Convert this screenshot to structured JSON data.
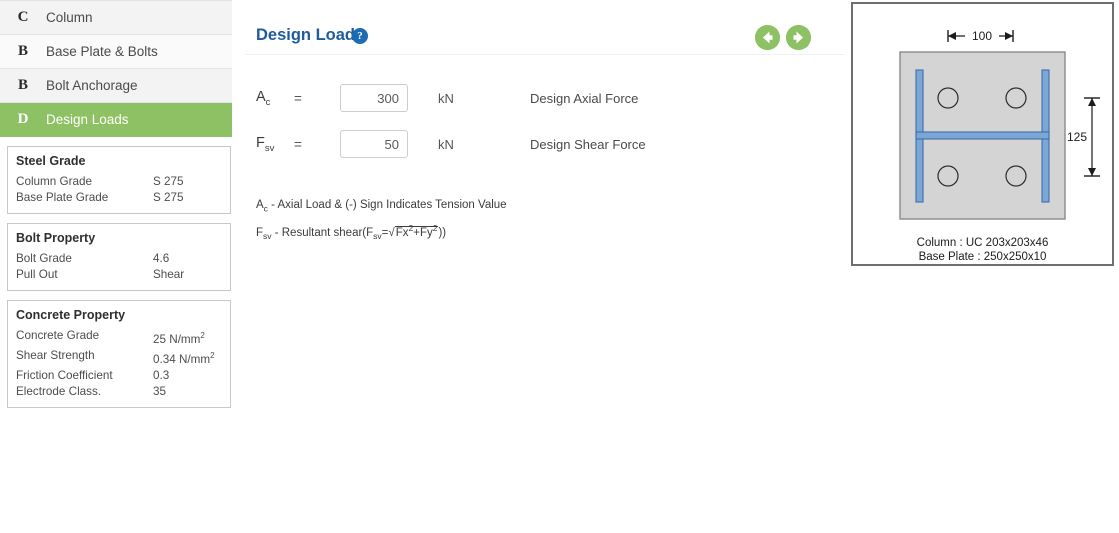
{
  "sidebar": {
    "items": [
      {
        "letter": "C",
        "label": "Column"
      },
      {
        "letter": "B",
        "label": "Base Plate & Bolts"
      },
      {
        "letter": "B",
        "label": "Bolt Anchorage"
      },
      {
        "letter": "D",
        "label": "Design Loads"
      }
    ],
    "panels": [
      {
        "title": "Steel Grade",
        "rows": [
          {
            "key": "Column Grade",
            "value": "S 275"
          },
          {
            "key": "Base Plate Grade",
            "value": "S 275"
          }
        ]
      },
      {
        "title": "Bolt Property",
        "rows": [
          {
            "key": "Bolt Grade",
            "value": "4.6"
          },
          {
            "key": "Pull Out",
            "value": "Shear"
          }
        ]
      },
      {
        "title": "Concrete Property",
        "rows": [
          {
            "key": "Concrete Grade",
            "value": "25 N/mm",
            "sup": "2"
          },
          {
            "key": "Shear Strength",
            "value": "0.34 N/mm",
            "sup": "2"
          },
          {
            "key": "Friction Coefficient",
            "value": "0.3"
          },
          {
            "key": "Electrode Class.",
            "value": "35"
          }
        ]
      }
    ]
  },
  "header": {
    "title": "Design Loads",
    "help_icon": "question-mark-icon",
    "prev_label": "previous-arrow-icon",
    "next_label": "next-arrow-icon"
  },
  "form": {
    "rows": [
      {
        "symbol": "A",
        "subscript": "c",
        "equals": "=",
        "value": "300",
        "unit": "kN",
        "description": "Design Axial Force"
      },
      {
        "symbol": "F",
        "subscript": "sv",
        "equals": "=",
        "value": "50",
        "unit": "kN",
        "description": "Design Shear Force"
      }
    ]
  },
  "notes": {
    "line1_symbol": "A",
    "line1_sub": "c",
    "line1_text": " - Axial Load & (-) Sign Indicates Tension Value",
    "line2_symbol": "F",
    "line2_sub": "sv",
    "line2_text": " - Resultant shear(",
    "line2_formula_lhs": "F",
    "line2_formula_lhs_sub": "sv",
    "line2_formula_eq": "=",
    "line2_radical": "√",
    "line2_inner_a": "Fx",
    "line2_inner_a_sup": "2",
    "line2_plus": "+",
    "line2_inner_b": "Fy",
    "line2_inner_b_sup": "2",
    "line2_close": "))"
  },
  "diagram": {
    "name": "base-plate-section-diagram",
    "width_dimension": "100",
    "height_dimension": "125",
    "caption_column": "Column : UC 203x203x46",
    "caption_base_plate": "Base Plate : 250x250x10",
    "colors": {
      "plate_fill": "#d4d4d4",
      "plate_stroke": "#8a8a8a",
      "steel_fill": "#7ba7d7",
      "steel_stroke": "#3f6ea8",
      "dimension_line": "#1c1c1c"
    }
  },
  "theme": {
    "accent_green": "#8dc163",
    "title_blue": "#1f5c9e",
    "help_blue": "#1c6cb5"
  }
}
